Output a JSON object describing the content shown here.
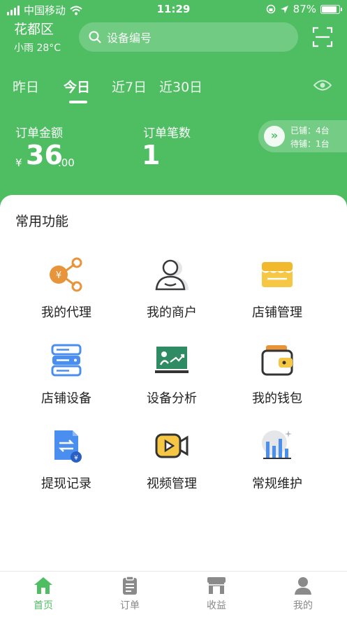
{
  "status_bar": {
    "carrier": "中国移动",
    "time": "11:29",
    "battery": "87%",
    "battery_level": 0.87
  },
  "header": {
    "city": "花都区",
    "weather": "小雨 28°C",
    "search_placeholder": "设备编号"
  },
  "tabs": [
    {
      "label": "昨日",
      "active": false
    },
    {
      "label": "今日",
      "active": true
    },
    {
      "label": "近7日",
      "active": false
    },
    {
      "label": "近30日",
      "active": false
    }
  ],
  "stats": {
    "amount_label": "订单金额",
    "currency": "¥",
    "amount_int": "36",
    "amount_dec": ".00",
    "count_label": "订单笔数",
    "count_value": "1",
    "deployed": "已铺：4台",
    "pending": "待铺：1台",
    "expand_glyph": "»"
  },
  "functions": {
    "title": "常用功能",
    "items": [
      {
        "label": "我的代理",
        "icon": "agent-icon"
      },
      {
        "label": "我的商户",
        "icon": "merchant-icon"
      },
      {
        "label": "店铺管理",
        "icon": "store-icon"
      },
      {
        "label": "店铺设备",
        "icon": "device-icon"
      },
      {
        "label": "设备分析",
        "icon": "analysis-icon"
      },
      {
        "label": "我的钱包",
        "icon": "wallet-icon"
      },
      {
        "label": "提现记录",
        "icon": "withdraw-icon"
      },
      {
        "label": "视频管理",
        "icon": "video-icon"
      },
      {
        "label": "常规维护",
        "icon": "maintenance-icon"
      }
    ]
  },
  "bottom_nav": [
    {
      "label": "首页",
      "icon": "home-icon",
      "active": true
    },
    {
      "label": "订单",
      "icon": "order-icon",
      "active": false
    },
    {
      "label": "收益",
      "icon": "earnings-icon",
      "active": false
    },
    {
      "label": "我的",
      "icon": "profile-icon",
      "active": false
    }
  ],
  "colors": {
    "brand": "#4fbe63",
    "orange": "#e8943a",
    "blue": "#4a8ff0",
    "yellow": "#f6c744",
    "dark": "#333333"
  }
}
